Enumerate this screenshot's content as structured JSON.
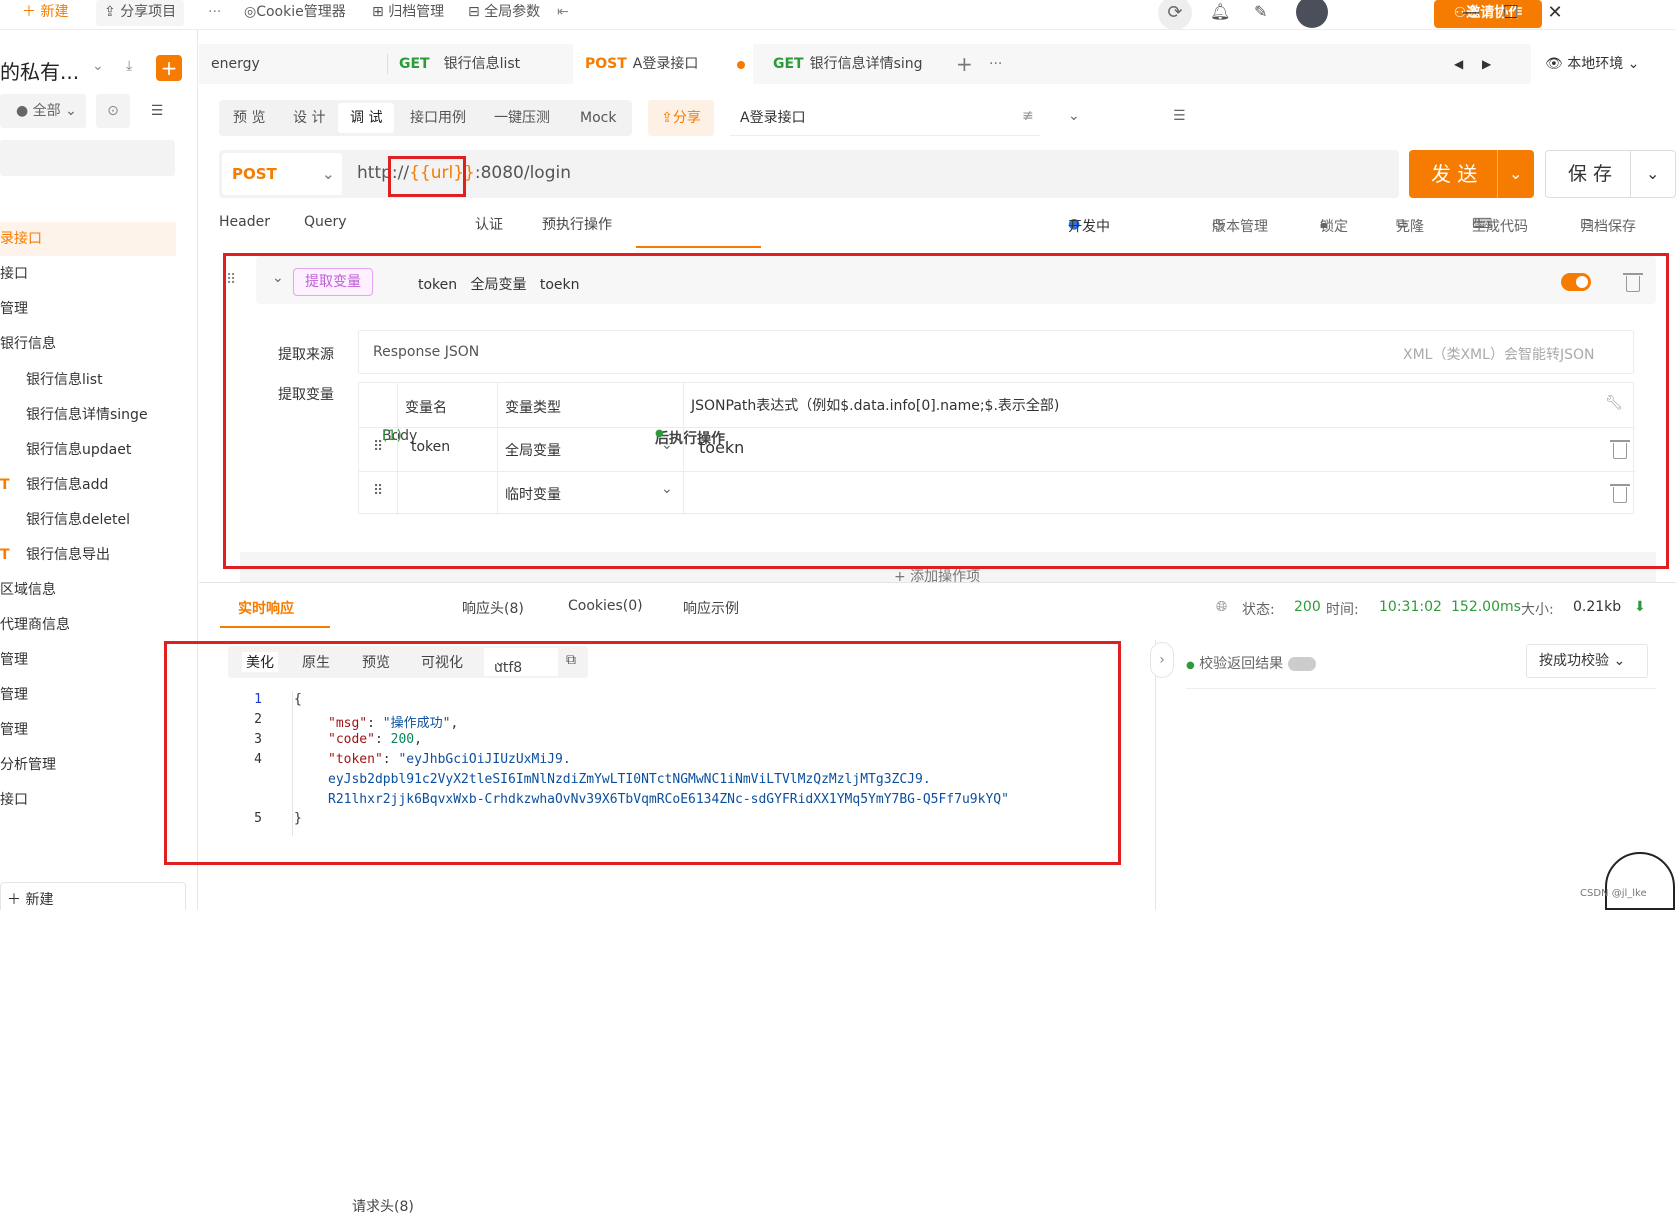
{
  "topbar": {
    "new_label": "新建",
    "share_label": "分享项目",
    "more": "···",
    "cookie_label": "Cookie管理器",
    "archive_label": "归档管理",
    "global_params_label": "全局参数",
    "invite_label": "邀请协作"
  },
  "sidebar": {
    "title": "的私有...",
    "filter_label": "全部",
    "items": [
      {
        "label": "录接口"
      },
      {
        "label": "接口"
      },
      {
        "label": "管理"
      },
      {
        "label": "银行信息"
      },
      {
        "label": "银行信息list"
      },
      {
        "label": "银行信息详情singe"
      },
      {
        "label": "银行信息updaet"
      },
      {
        "label": "银行信息add",
        "method": "T"
      },
      {
        "label": "银行信息deletel"
      },
      {
        "label": "银行信息导出",
        "method": "T"
      },
      {
        "label": "区域信息"
      },
      {
        "label": "代理商信息"
      },
      {
        "label": "管理"
      },
      {
        "label": "管理"
      },
      {
        "label": "管理"
      },
      {
        "label": "分析管理"
      },
      {
        "label": "接口"
      }
    ],
    "new_label": "新建"
  },
  "tabs": [
    {
      "method": "",
      "label": "energy"
    },
    {
      "method": "GET",
      "label": "银行信息list"
    },
    {
      "method": "POST",
      "label": "A登录接口"
    },
    {
      "method": "GET",
      "label": "银行信息详情sing"
    }
  ],
  "environment": "本地环境",
  "subnav": {
    "items": [
      "预 览",
      "设 计",
      "调 试",
      "接口用例",
      "一键压测",
      "Mock"
    ],
    "share_label": "分享",
    "api_name": "A登录接口",
    "status_label": "开发中",
    "version_label": "版本管理",
    "lock_label": "锁定",
    "clone_label": "克隆",
    "codegen_label": "生成代码",
    "archive_label": "归档保存"
  },
  "request": {
    "method": "POST",
    "url_prefix": "http://",
    "url_var": "{{url}}",
    "url_suffix": ":8080/login",
    "send_label": "发 送",
    "save_label": "保 存"
  },
  "request_tabs": [
    "Header",
    "Query",
    "Body",
    "(1)",
    "认证",
    "预执行操作",
    "后执行操作"
  ],
  "post_op": {
    "tag_label": "提取变量",
    "summary_var": "token",
    "summary_type": "全局变量",
    "summary_expr": "toekn",
    "source_label": "提取来源",
    "source_value": "Response JSON",
    "source_hint": "XML（类XML）会智能转JSON",
    "vars_label": "提取变量",
    "col_name": "变量名",
    "col_type": "变量类型",
    "col_expr": "JSONPath表达式（例如$.data.info[0].name;$.表示全部)",
    "rows": [
      {
        "name": "token",
        "type": "全局变量",
        "expr": "toekn"
      },
      {
        "name": "",
        "type": "临时变量",
        "expr": ""
      }
    ],
    "add_label": "+ 添加操作项"
  },
  "response": {
    "tabs": [
      "实时响应",
      "请求头(8)",
      "响应头(8)",
      "Cookies(0)",
      "响应示例"
    ],
    "status_label": "状态:",
    "status_value": "200",
    "time_label": "时间:",
    "time_value": "10:31:02",
    "duration": "152.00ms",
    "size_label": "大小:",
    "size_value": "0.21kb",
    "format_tabs": [
      "美化",
      "原生",
      "预览",
      "可视化"
    ],
    "encoding": "utf8",
    "validate_label": "校验返回结果",
    "validate_mode": "按成功校验",
    "code": {
      "l1": "{",
      "msg_key": "\"msg\"",
      "msg_val": "\"操作成功\"",
      "code_key": "\"code\"",
      "code_val": "200",
      "token_key": "\"token\"",
      "token_l1": "\"eyJhbGciOiJIUzUxMiJ9.",
      "token_l2": "eyJsb2dpbl91c2VyX2tleSI6ImNlNzdiZmYwLTI0NTctNGMwNC1iNmViLTVlMzQzMzljMTg3ZCJ9.",
      "token_l3": "R21lhxr2jjk6BqvxWxb-CrhdkzwhaOvNv39X6TbVqmRCoE6134ZNc-sdGYFRidXX1YMq5YmY7BG-Q5Ff7u9kYQ\"",
      "l5": "}",
      "line_numbers": [
        "1",
        "2",
        "3",
        "4",
        "5"
      ]
    }
  },
  "watermark": "CSDN @jl_lke"
}
